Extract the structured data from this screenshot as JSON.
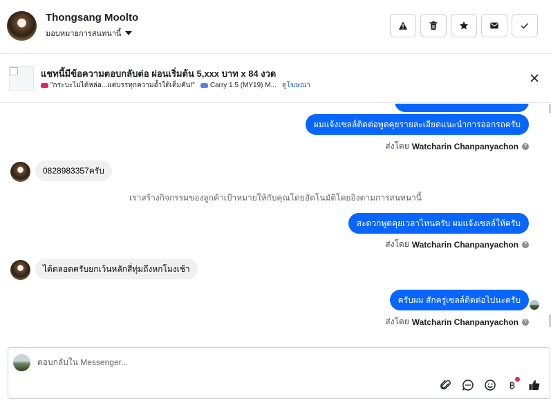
{
  "header": {
    "contact_name": "Thongsang Moolto",
    "assign_label": "มอบหมายการสนทนานี้",
    "actions": [
      {
        "name": "report-spam",
        "icon": "warning-icon"
      },
      {
        "name": "delete",
        "icon": "trash-icon"
      },
      {
        "name": "star",
        "icon": "star-icon"
      },
      {
        "name": "mark-unread",
        "icon": "envelope-icon"
      },
      {
        "name": "mark-done",
        "icon": "check-icon"
      }
    ]
  },
  "ad": {
    "title": "แชทนี้มีข้อความตอบกลับต่อ ผ่อนเริ่มต้น 5,xxx บาท x 84 งวด",
    "subtitle_part1": "\"กระบะไม่ได้หล่อ...แต่บรรทุกความอ้ำใต้เต็มคัน!\"",
    "subtitle_part2": "Carry 1.5 (MY19) M...",
    "link": "ดูโฆษณา"
  },
  "messages": {
    "out_1": "ผมแจ้งเซลล์ติดต่อพูดคุยรายละเอียดแนะนำการออกรถครับ",
    "sent_by_1_prefix": "ส่งโดย",
    "sent_by_1_name": "Watcharin Chanpanyachon",
    "in_1": "0828983357ครับ",
    "system_note": "เราสร้างกิจกรรมของลูกค้าเป้าหมายให้กับคุณโดยอัตโนมัติโดยอิงตามการสนทนานี้",
    "out_2": "สะดวกพูดคุยเวลาไหนครับ ผมแจ้งเซลล์ให้ครับ",
    "sent_by_2_prefix": "ส่งโดย",
    "sent_by_2_name": "Watcharin Chanpanyachon",
    "in_2": "ได้ตลอดครับยกเว้นหลักสี่ทุ่มถึงหกโมงเช้า",
    "out_3": "ครับผม สักครู่เซลล์ติดต่อไปนะครับ",
    "sent_by_3_prefix": "ส่งโดย",
    "sent_by_3_name": "Watcharin Chanpanyachon"
  },
  "composer": {
    "placeholder": "ตอบกลับใน Messenger...",
    "tools": [
      "attachment-icon",
      "saved-reply-icon",
      "emoji-icon",
      "payment-icon",
      "like-icon"
    ]
  },
  "colors": {
    "outgoing_bubble": "#0866ff",
    "incoming_bubble": "#f0f0f0",
    "link": "#1a61c9",
    "notification_dot": "#f02849"
  }
}
